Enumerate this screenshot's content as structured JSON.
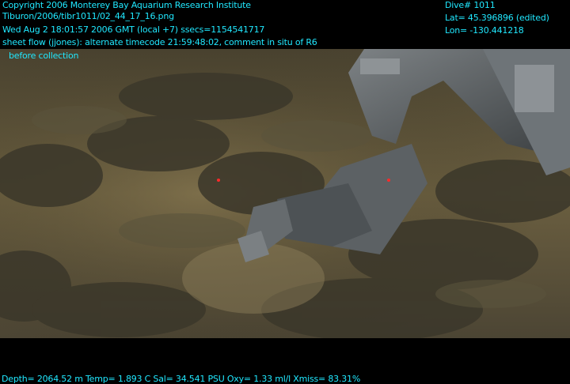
{
  "overlay": {
    "copyright": "Copyright 2006 Monterey Bay Aquarium Research Institute",
    "file_path": "Tiburon/2006/tibr1011/02_44_17_16.png",
    "timestamp": "Wed Aug  2 18:01:57 2006 GMT (local +7)  ssecs=1154541717",
    "note": "sheet flow (jjones): alternate timecode 21:59:48:02, comment in situ of R6",
    "subnote": "before collection",
    "dive": "Dive# 1011",
    "lat": "Lat= 45.396896 (edited)",
    "lon": "Lon= -130.441218",
    "sensors": "Depth= 2064.52 m  Temp= 1.893 C  Sal= 34.541 PSU  Oxy= 1.33 ml/l  Xmiss= 83.31%"
  },
  "colors": {
    "overlay_text": "#20e8ff",
    "background": "#000000"
  }
}
